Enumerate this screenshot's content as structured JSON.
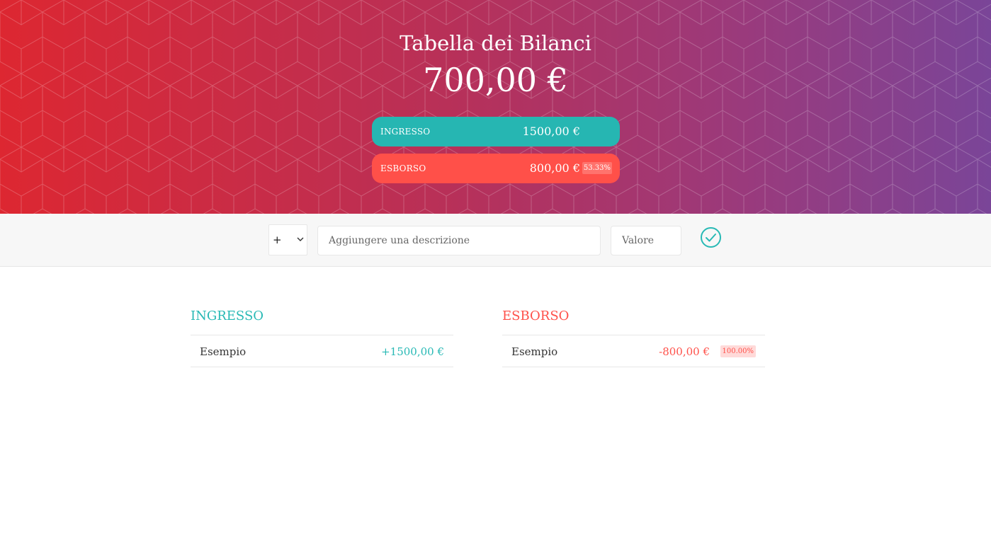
{
  "header": {
    "title": "Tabella dei Bilanci",
    "balance": "700,00 €",
    "income": {
      "label": "INGRESSO",
      "value": "1500,00 €"
    },
    "expense": {
      "label": "ESBORSO",
      "value": "800,00 €",
      "percentage": "53.33%"
    }
  },
  "add_form": {
    "type_selected": "+",
    "description_placeholder": "Aggiungere una descrizione",
    "value_placeholder": "Valore",
    "confirm_icon": "check-circle-icon"
  },
  "income_list": {
    "title": "INGRESSO",
    "items": [
      {
        "description": "Esempio",
        "value": "+1500,00 €"
      }
    ]
  },
  "expense_list": {
    "title": "ESBORSO",
    "items": [
      {
        "description": "Esempio",
        "value": "-800,00 €",
        "percentage": "100.00%"
      }
    ]
  },
  "colors": {
    "income": "#28b9b5",
    "expense": "#ff5049",
    "gradient_start": "#dd2731",
    "gradient_end": "#7a4598"
  }
}
